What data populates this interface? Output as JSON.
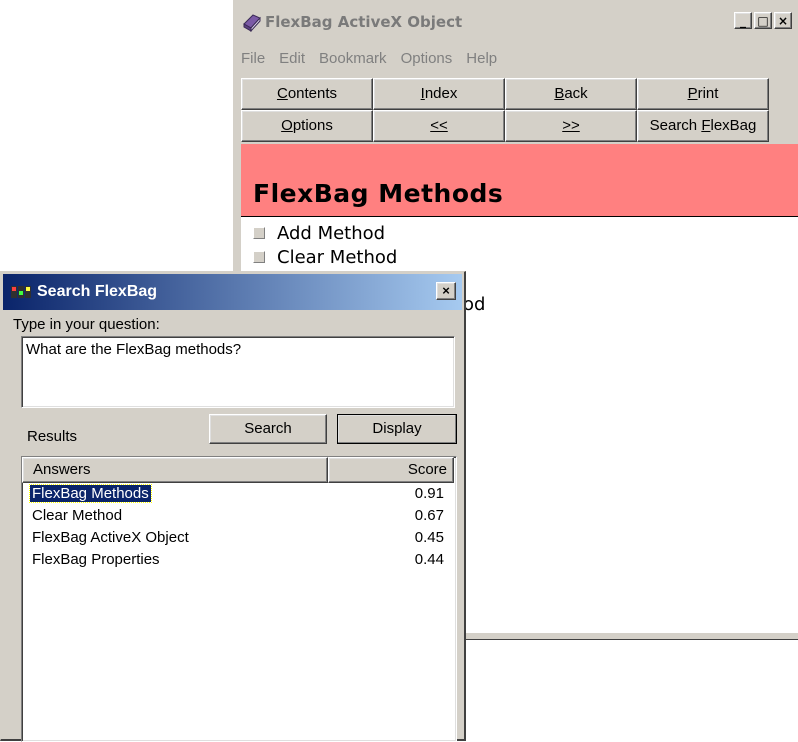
{
  "help_window": {
    "title": "FlexBag ActiveX Object",
    "menu": [
      "File",
      "Edit",
      "Bookmark",
      "Options",
      "Help"
    ],
    "minimize_label": "_",
    "maximize_label": "□",
    "close_label": "×",
    "nav_row1": [
      {
        "label_before": "",
        "underline": "C",
        "label_after": "ontents"
      },
      {
        "label_before": "",
        "underline": "I",
        "label_after": "ndex"
      },
      {
        "label_before": "",
        "underline": "B",
        "label_after": "ack"
      },
      {
        "label_before": "",
        "underline": "P",
        "label_after": "rint"
      }
    ],
    "nav_row2": [
      {
        "label_before": "",
        "underline": "O",
        "label_after": "ptions"
      },
      {
        "label_before": "",
        "underline": "<<",
        "label_after": ""
      },
      {
        "label_before": "",
        "underline": ">>",
        "label_after": ""
      },
      {
        "label_before": "Search ",
        "underline": "F",
        "label_after": "lexBag"
      }
    ],
    "topic_title": "FlexBag Methods",
    "topics": [
      "Add Method",
      "Clear Method"
    ],
    "partial_text": "od"
  },
  "search_dialog": {
    "title": "Search FlexBag",
    "close_label": "×",
    "question_label": "Type in your question:",
    "question_value": "What are the FlexBag methods?",
    "search_button": "Search",
    "display_button": "Display",
    "results_label": "Results",
    "columns": {
      "answers": "Answers",
      "score": "Score"
    },
    "results": [
      {
        "answer": "FlexBag Methods",
        "score": "0.91",
        "selected": true
      },
      {
        "answer": "Clear Method",
        "score": "0.67",
        "selected": false
      },
      {
        "answer": "FlexBag ActiveX Object",
        "score": "0.45",
        "selected": false
      },
      {
        "answer": "FlexBag Properties",
        "score": "0.44",
        "selected": false
      }
    ]
  },
  "colors": {
    "banner": "#ff8080",
    "titlebar_active": "#0a246a",
    "selection": "#0a246a",
    "face": "#d4d0c8"
  },
  "icons": [
    "book-app-icon",
    "search-app-icon",
    "close-icon",
    "minimize-icon",
    "maximize-icon"
  ]
}
